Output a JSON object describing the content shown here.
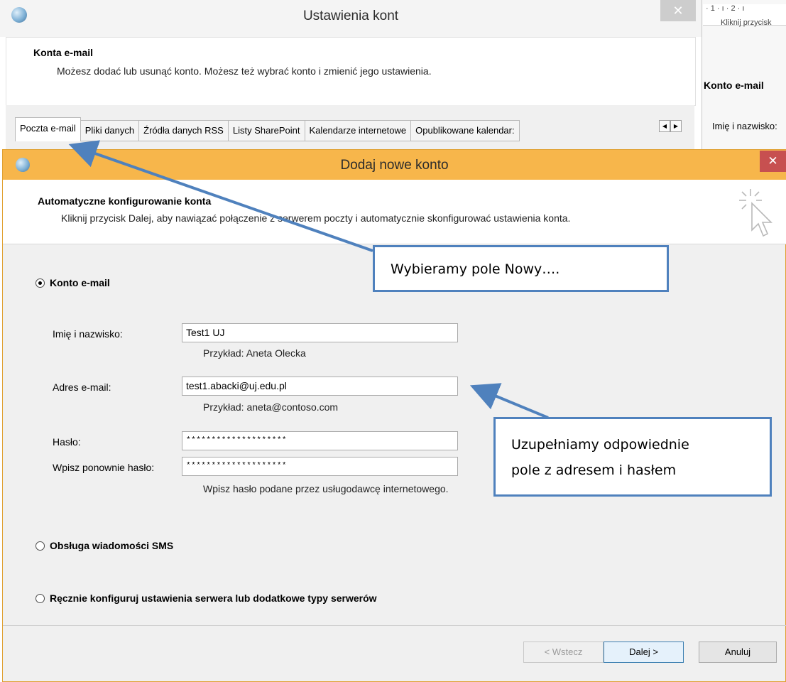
{
  "background_window": {
    "title": "Ustawienia kont",
    "close": "✕",
    "header_title": "Konta e-mail",
    "header_subtitle": "Możesz dodać lub usunąć konto. Możesz też wybrać konto i zmienić jego ustawienia.",
    "tabs": [
      {
        "label": "Poczta e-mail",
        "active": true
      },
      {
        "label": "Pliki danych",
        "active": false
      },
      {
        "label": "Źródła danych RSS",
        "active": false
      },
      {
        "label": "Listy SharePoint",
        "active": false
      },
      {
        "label": "Kalendarze internetowe",
        "active": false
      },
      {
        "label": "Opublikowane kalendar:",
        "active": false
      }
    ],
    "tab_scroll_left": "◀",
    "tab_scroll_right": "▶"
  },
  "right_document": {
    "ruler": "· 1 · ı · 2 · ı",
    "ruler_text": "Kliknij przycisk",
    "radio_label": "Konto e-mail",
    "name_label": "Imię i nazwisko:"
  },
  "dialog": {
    "title": "Dodaj nowe konto",
    "close": "✕",
    "header_title": "Automatyczne konfigurowanie konta",
    "header_subtitle": "Kliknij przycisk Dalej, aby nawiązać połączenie z serwerem poczty i automatycznie skonfigurować ustawienia konta.",
    "options": {
      "email_account": {
        "label": "Konto e-mail",
        "selected": true
      },
      "sms": {
        "label": "Obsługa wiadomości SMS",
        "selected": false
      },
      "manual": {
        "label": "Ręcznie konfiguruj ustawienia serwera lub dodatkowe typy serwerów",
        "selected": false
      }
    },
    "fields": {
      "name": {
        "label": "Imię i nazwisko:",
        "value": "Test1 UJ",
        "hint": "Przykład: Aneta Olecka"
      },
      "email": {
        "label": "Adres e-mail:",
        "value": "test1.abacki@uj.edu.pl",
        "hint": "Przykład: aneta@contoso.com"
      },
      "password": {
        "label": "Hasło:",
        "value": "********************"
      },
      "password_repeat": {
        "label": "Wpisz ponownie hasło:",
        "value": "********************",
        "hint": "Wpisz hasło podane przez usługodawcę internetowego."
      }
    },
    "buttons": {
      "back": "< Wstecz",
      "next": "Dalej >",
      "cancel": "Anuluj"
    }
  },
  "annotations": {
    "callout_new": "Wybieramy pole Nowy….",
    "callout_fill_line1": "Uzupełniamy odpowiednie",
    "callout_fill_line2": "pole z adresem i hasłem",
    "arrow_color": "#4f81bd"
  }
}
